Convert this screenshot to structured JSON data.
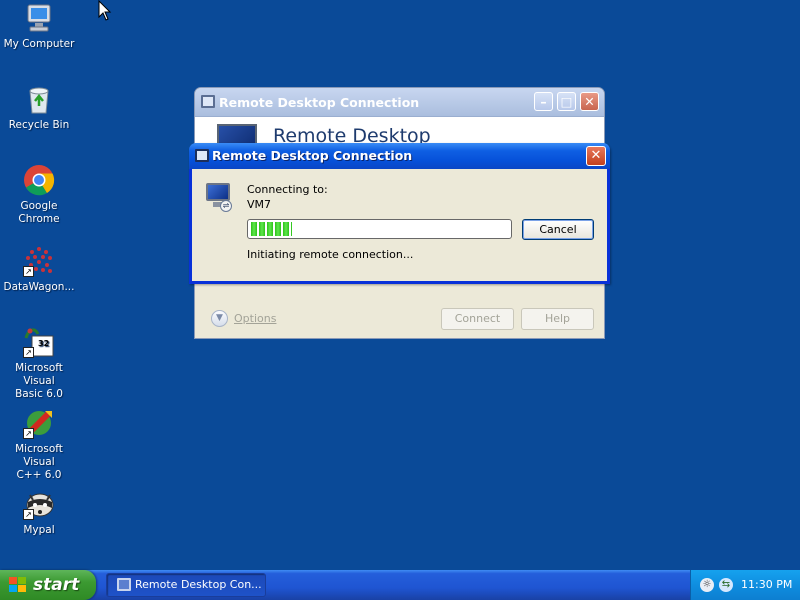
{
  "desktop": {
    "icons": [
      {
        "label": "My Computer",
        "icon": "my-computer-icon"
      },
      {
        "label": "Recycle Bin",
        "icon": "recycle-bin-icon"
      },
      {
        "label": "Google Chrome",
        "icon": "chrome-icon"
      },
      {
        "label": "DataWagon...",
        "icon": "datawagon-icon"
      },
      {
        "label_line1": "Microsoft Visual",
        "label_line2": "Basic 6.0",
        "icon": "visual-basic-icon"
      },
      {
        "label_line1": "Microsoft Visual",
        "label_line2": "C++ 6.0",
        "icon": "visual-cpp-icon"
      },
      {
        "label": "Mypal",
        "icon": "mypal-icon"
      }
    ],
    "background_color": "#0a4a98"
  },
  "back_window": {
    "title": "Remote Desktop Connection",
    "banner_text": "Remote Desktop",
    "options_label": "Options",
    "connect_label": "Connect",
    "help_label": "Help"
  },
  "dialog": {
    "title": "Remote Desktop Connection",
    "connecting_label": "Connecting to:",
    "target": "VM7",
    "progress_fraction": 0.16,
    "cancel_label": "Cancel",
    "status": "Initiating remote connection...",
    "accent_color": "#0831d9"
  },
  "taskbar": {
    "start_label": "start",
    "task_label": "Remote Desktop Con...",
    "clock": "11:30 PM"
  }
}
